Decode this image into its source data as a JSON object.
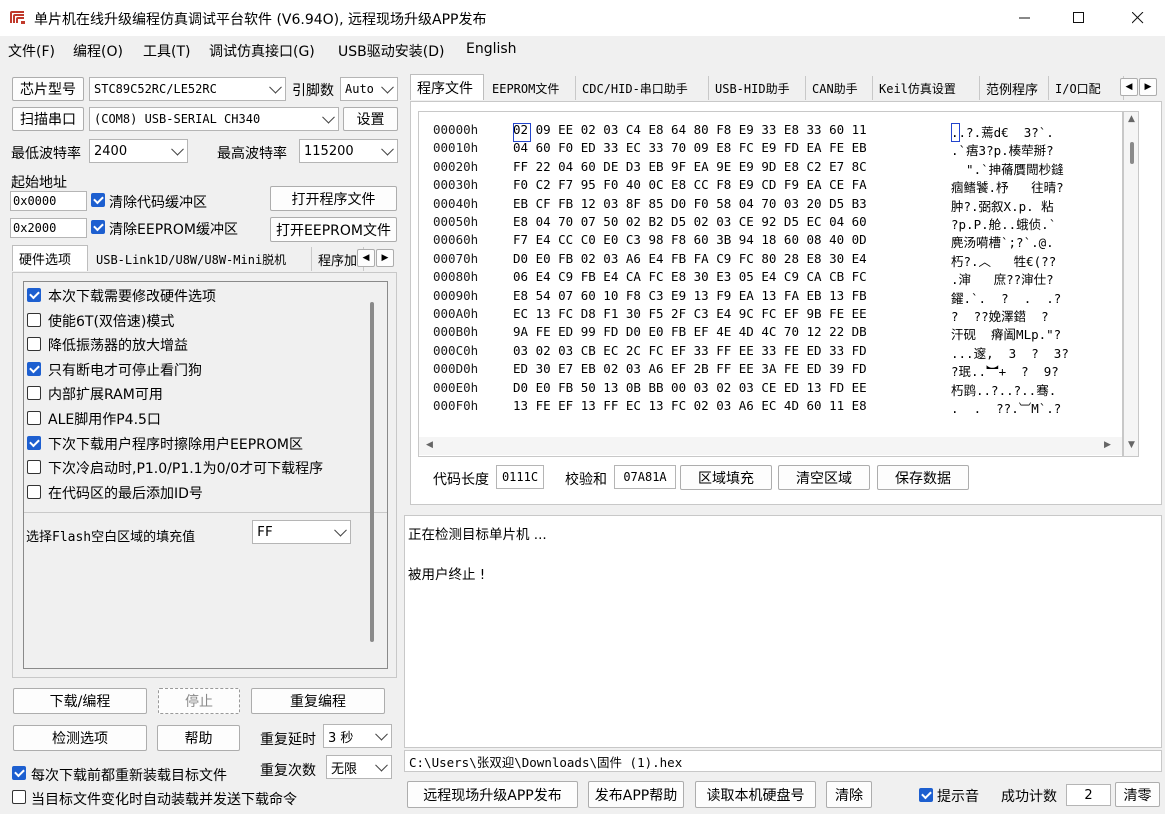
{
  "window": {
    "title": "单片机在线升级编程仿真调试平台软件 (V6.94O), 远程现场升级APP发布"
  },
  "menu": [
    "文件(F)",
    "编程(O)",
    "工具(T)",
    "调试仿真接口(G)",
    "USB驱动安装(D)",
    "English"
  ],
  "left": {
    "chip_btn": "芯片型号",
    "chip_value": "STC89C52RC/LE52RC",
    "pin_label": "引脚数",
    "pin_value": "Auto",
    "scan_btn": "扫描串口",
    "port_value": "(COM8) USB-SERIAL CH340",
    "settings_btn": "设置",
    "min_baud_label": "最低波特率",
    "min_baud_value": "2400",
    "max_baud_label": "最高波特率",
    "max_baud_value": "115200",
    "start_addr_label": "起始地址",
    "addr1": "0x0000",
    "clear_code_label": "清除代码缓冲区",
    "open_prog_btn": "打开程序文件",
    "addr2": "0x2000",
    "clear_eeprom_label": "清除EEPROM缓冲区",
    "open_eeprom_btn": "打开EEPROM文件",
    "tabs": [
      "硬件选项",
      "USB-Link1D/U8W/U8W-Mini脱机",
      "程序加"
    ],
    "options": [
      {
        "label": "本次下载需要修改硬件选项",
        "checked": true
      },
      {
        "label": "使能6T(双倍速)模式",
        "checked": false
      },
      {
        "label": "降低振荡器的放大增益",
        "checked": false
      },
      {
        "label": "只有断电才可停止看门狗",
        "checked": true
      },
      {
        "label": "内部扩展RAM可用",
        "checked": false
      },
      {
        "label": "ALE脚用作P4.5口",
        "checked": false
      },
      {
        "label": "下次下载用户程序时擦除用户EEPROM区",
        "checked": true
      },
      {
        "label": "下次冷启动时,P1.0/P1.1为0/0才可下载程序",
        "checked": false
      },
      {
        "label": "在代码区的最后添加ID号",
        "checked": false
      }
    ],
    "fill_label": "选择Flash空白区域的填充值",
    "fill_value": "FF",
    "download_btn": "下载/编程",
    "stop_btn": "停止",
    "repeat_btn": "重复编程",
    "detect_btn": "检测选项",
    "help_btn": "帮助",
    "repeat_delay_label": "重复延时",
    "repeat_delay_value": "3 秒",
    "repeat_count_label": "重复次数",
    "repeat_count_value": "无限",
    "reload_label": "每次下载前都重新装载目标文件",
    "reload_checked": true,
    "auto_label": "当目标文件变化时自动装载并发送下载命令",
    "auto_checked": false
  },
  "right": {
    "tabs": [
      "程序文件",
      "EEPROM文件",
      "CDC/HID-串口助手",
      "USB-HID助手",
      "CAN助手",
      "Keil仿真设置",
      "范例程序",
      "I/O口配"
    ],
    "hex_rows": [
      {
        "addr": "00000h",
        "bytes": "02 09 EE 02 03 C4 E8 64 80 F8 E9 33 E8 33 60 11",
        "ascii": "..?.蔫d€  3?`."
      },
      {
        "addr": "00010h",
        "bytes": "04 60 F0 ED 33 EC 33 70 09 E8 FC E9 FD EA FE EB",
        "ascii": ".`痦3?p.楱荦掰?"
      },
      {
        "addr": "00020h",
        "bytes": "FF 22 04 60 DE D3 EB 9F EA 9E E9 9D E8 C2 E7 8C",
        "ascii": "  \".`抻蓨贋閜杪鏠"
      },
      {
        "addr": "00030h",
        "bytes": "F0 C2 F7 95 F0 40 0C E8 CC F8 E9 CD F9 EA CE FA",
        "ascii": "痼鳍饕.杼   往晴?"
      },
      {
        "addr": "00040h",
        "bytes": "EB CF FB 12 03 8F 85 D0 F0 58 04 70 03 20 D5 B3",
        "ascii": "肿?.弼叙X.p. 粘"
      },
      {
        "addr": "00050h",
        "bytes": "E8 04 70 07 50 02 B2 D5 02 03 CE 92 D5 EC 04 60",
        "ascii": "?p.P.舱..蛾侦.`"
      },
      {
        "addr": "00060h",
        "bytes": "F7 E4 CC C0 E0 C3 98 F8 60 3B 94 18 60 08 40 0D",
        "ascii": "麂汤嗬槽`;?`.@."
      },
      {
        "addr": "00070h",
        "bytes": "D0 E0 FB 02 03 A6 E4 FB FA C9 FC 80 28 E8 30 E4",
        "ascii": "朽?.︿   牲€(??"
      },
      {
        "addr": "00080h",
        "bytes": "06 E4 C9 FB E4 CA FC E8 30 E3 05 E4 C9 CA CB FC",
        "ascii": ".渖   庶??渖仕?"
      },
      {
        "addr": "00090h",
        "bytes": "E8 54 07 60 10 F8 C3 E9 13 F9 EA 13 FA EB 13 FB",
        "ascii": "鑃.`.  ?  .  .?"
      },
      {
        "addr": "000A0h",
        "bytes": "EC 13 FC D8 F1 30 F5 2F C3 E4 9C FC EF 9B FE EE",
        "ascii": "?  ??娩澤鍣  ?"
      },
      {
        "addr": "000B0h",
        "bytes": "9A FE ED 99 FD D0 E0 FB EF 4E 4D 4C 70 12 22 DB",
        "ascii": "汗砚  瘠阖MLp.\"?"
      },
      {
        "addr": "000C0h",
        "bytes": "03 02 03 CB EC 2C FC EF 33 FF EE 33 FE ED 33 FD",
        "ascii": "...邃,  3  ?  3?"
      },
      {
        "addr": "000D0h",
        "bytes": "ED 30 E7 EB 02 03 A6 EF 2B FF EE 3A FE ED 39 FD",
        "ascii": "?珉..︼+  ?  9?"
      },
      {
        "addr": "000E0h",
        "bytes": "D0 E0 FB 50 13 0B BB 00 03 02 03 CE ED 13 FD EE",
        "ascii": "朽鹍..?..?..骞."
      },
      {
        "addr": "000F0h",
        "bytes": "13 FE EF 13 FF EC 13 FC 02 03 A6 EC 4D 60 11 E8",
        "ascii": ".  .  ??.︺M`.?"
      }
    ],
    "code_len_label": "代码长度",
    "code_len_value": "0111C",
    "checksum_label": "校验和",
    "checksum_value": "07A81A",
    "fill_btn": "区域填充",
    "clear_area_btn": "清空区域",
    "save_btn": "保存数据",
    "log": [
      "正在检测目标单片机 ...",
      "",
      "被用户终止 !"
    ],
    "file_path": "C:\\Users\\张双迎\\Downloads\\固件 (1).hex",
    "publish_btn": "远程现场升级APP发布",
    "publish_help_btn": "发布APP帮助",
    "read_disk_btn": "读取本机硬盘号",
    "clear_btn": "清除",
    "beep_label": "提示音",
    "beep_checked": true,
    "success_label": "成功计数",
    "success_value": "2",
    "reset_btn": "清零"
  }
}
